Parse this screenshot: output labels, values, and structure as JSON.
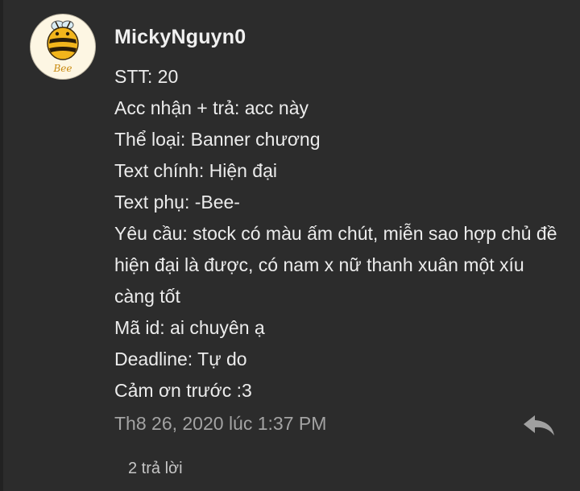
{
  "comment": {
    "avatar_icon": "bee-avatar-icon",
    "avatar_label": "Bee",
    "author": "MickyNguyn0",
    "lines": [
      "STT: 20",
      "Acc nhận + trả: acc này",
      "Thể loại: Banner chương",
      "Text chính: Hiện đại",
      "Text phụ: -Bee-",
      "Yêu cầu: stock có màu ấm chút, miễn sao hợp chủ đề hiện đại là được, có nam x nữ thanh xuân một xíu càng tốt",
      "Mã id: ai chuyên ạ",
      "Deadline: Tự do",
      "Cảm ơn trước :3"
    ],
    "timestamp": "Th8 26, 2020 lúc 1:37 PM",
    "reply_icon": "reply-arrow-icon",
    "replies_label": "2 trả lời"
  },
  "colors": {
    "background": "#2c2c2c",
    "text": "#ececec",
    "muted": "#a3a3a3",
    "accent_bee": "#f2b51c"
  }
}
